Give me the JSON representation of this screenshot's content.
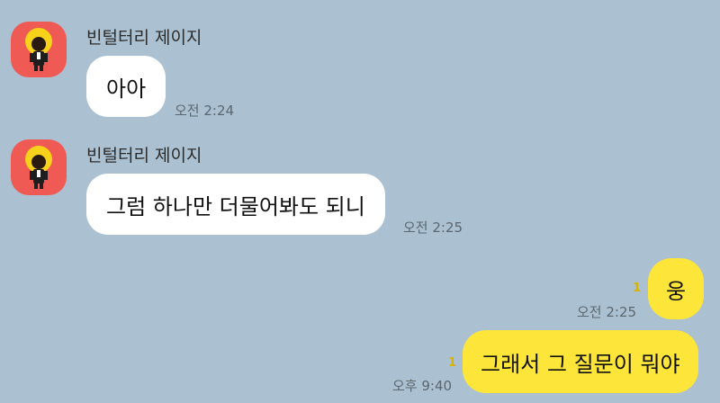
{
  "colors": {
    "background": "#abc1d1",
    "incoming_bubble": "#ffffff",
    "outgoing_bubble": "#fde53a",
    "avatar_bg": "#f05a55",
    "unread": "#d8b400"
  },
  "messages": [
    {
      "sender": "빈털터리 제이지",
      "avatar_icon": "profile-avatar-icon",
      "text": "아아",
      "time": "오전 2:24"
    },
    {
      "sender": "빈털터리 제이지",
      "avatar_icon": "profile-avatar-icon",
      "text": "그럼 하나만 더물어봐도 되니",
      "time": "오전 2:25"
    },
    {
      "text": "웅",
      "time": "오전 2:25",
      "unread": "1"
    },
    {
      "text": "그래서 그 질문이 뭐야",
      "time": "오후 9:40",
      "unread": "1"
    }
  ]
}
